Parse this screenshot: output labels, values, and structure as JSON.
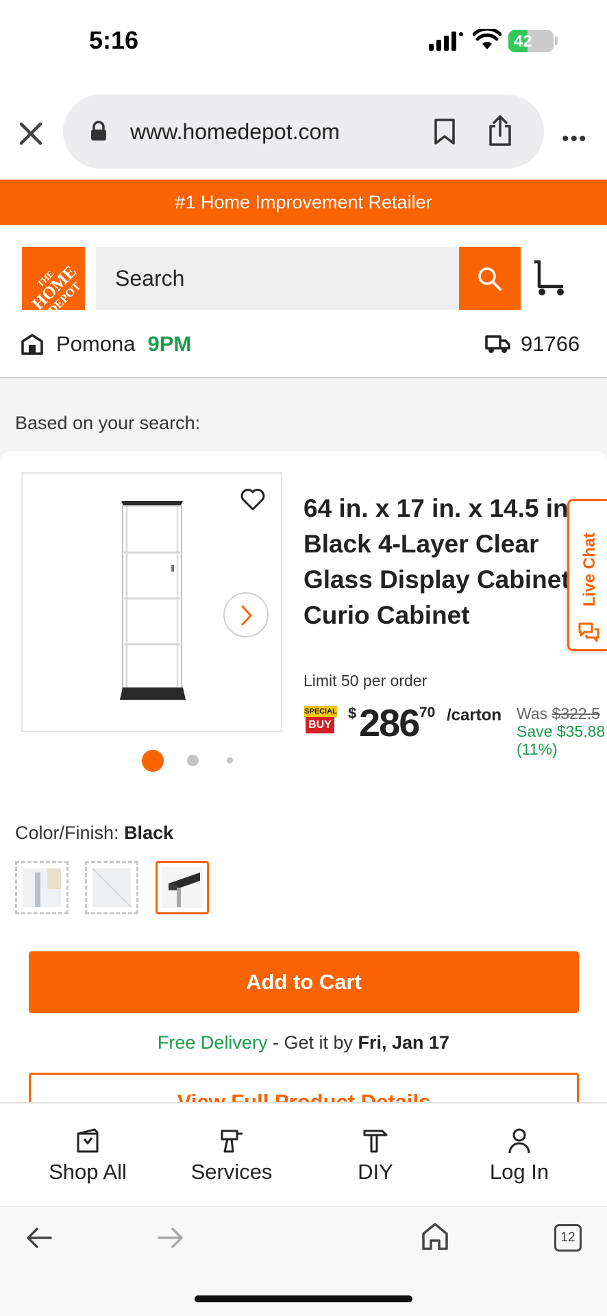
{
  "status_bar": {
    "time": "5:16",
    "battery": "42",
    "battery_level": 0.42
  },
  "browser": {
    "url": "www.homedepot.com",
    "tab_count": "12"
  },
  "promo_banner": "#1 Home Improvement Retailer",
  "header": {
    "logo_text": [
      "THE",
      "HOME",
      "DEPOT"
    ],
    "search_placeholder": "Search",
    "store_name": "Pomona",
    "store_hours": "9PM",
    "zip": "91766"
  },
  "content": {
    "section_label": "Based on your search:",
    "product": {
      "title": "64 in. x 17 in. x 14.5 in. Black 4-Layer Clear Glass Display Cabinet Curio Cabinet",
      "limit": "Limit 50 per order",
      "special_top": "SPECIAL",
      "special_bottom": "BUY",
      "price_currency": "$",
      "price_dollars": "286",
      "price_cents": "70",
      "price_unit": "/carton",
      "was_label": "Was",
      "was_price": "$322.5",
      "save_text": "Save $35.88",
      "save_pct": "(11%)",
      "image_count": 3,
      "active_image": 1
    },
    "color": {
      "label": "Color/Finish:",
      "value": "Black"
    },
    "add_to_cart": "Add to Cart",
    "delivery": {
      "free": "Free Delivery",
      "mid": " - Get it by ",
      "date": "Fri, Jan 17"
    },
    "view_details": "View Full Product Details"
  },
  "live_chat": "Live Chat",
  "bottom_nav": [
    {
      "label": "Shop All",
      "icon": "shop-all-icon"
    },
    {
      "label": "Services",
      "icon": "drill-icon"
    },
    {
      "label": "DIY",
      "icon": "hammer-icon"
    },
    {
      "label": "Log In",
      "icon": "user-icon"
    }
  ],
  "colors": {
    "brand": "#f96302",
    "green": "#1a9c4a"
  }
}
